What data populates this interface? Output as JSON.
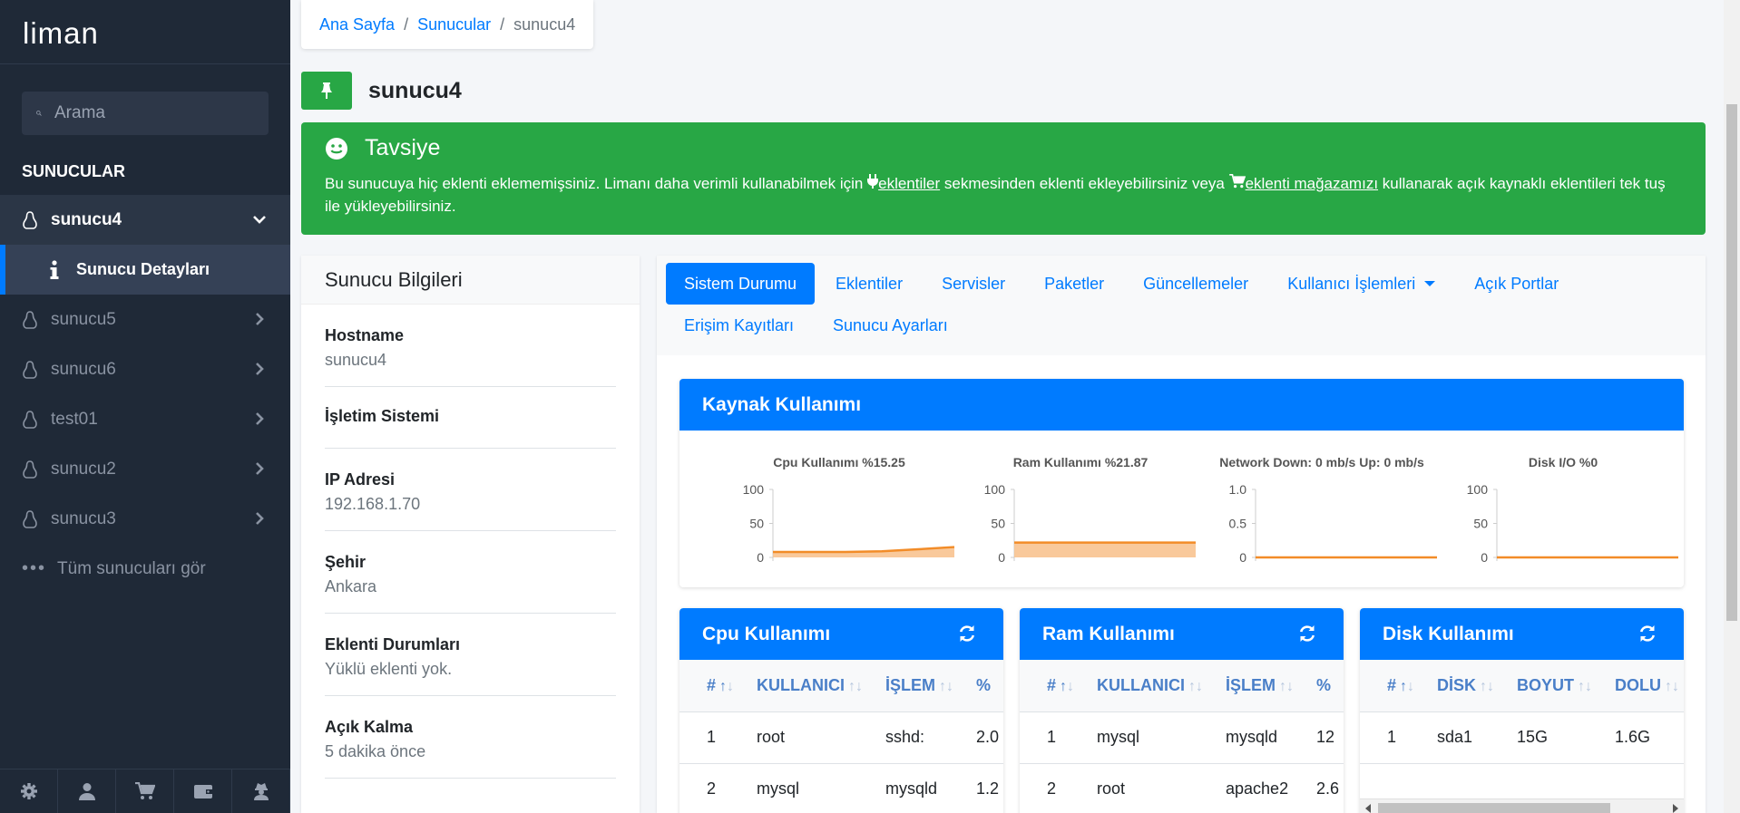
{
  "app": {
    "logo": "liman"
  },
  "sidebar": {
    "search_placeholder": "Arama",
    "section_title": "SUNUCULAR",
    "servers": [
      {
        "label": "sunucu4",
        "active": true
      },
      {
        "label": "sunucu5"
      },
      {
        "label": "sunucu6"
      },
      {
        "label": "test01"
      },
      {
        "label": "sunucu2"
      },
      {
        "label": "sunucu3"
      }
    ],
    "sub_item": "Sunucu Detayları",
    "see_all": "Tüm sunucuları gör"
  },
  "breadcrumb": {
    "home": "Ana Sayfa",
    "servers": "Sunucular",
    "current": "sunucu4"
  },
  "page": {
    "title": "sunucu4"
  },
  "alert": {
    "title": "Tavsiye",
    "text_1": "Bu sunucuya hiç eklenti eklememişsiniz. Limanı daha verimli kullanabilmek için ",
    "link_1": "eklentiler",
    "text_2": " sekmesinden eklenti ekleyebilirsiniz veya ",
    "link_2": "eklenti mağazamızı",
    "text_3": " kullanarak açık kaynaklı eklentileri tek tuş ile yükleyebilirsiniz."
  },
  "info": {
    "title": "Sunucu Bilgileri",
    "rows": [
      {
        "key": "Hostname",
        "value": "sunucu4"
      },
      {
        "key": "İşletim Sistemi",
        "value": ""
      },
      {
        "key": "IP Adresi",
        "value": "192.168.1.70"
      },
      {
        "key": "Şehir",
        "value": "Ankara"
      },
      {
        "key": "Eklenti Durumları",
        "value": "Yüklü eklenti yok."
      },
      {
        "key": "Açık Kalma",
        "value": "5 dakika önce"
      }
    ]
  },
  "tabs": [
    "Sistem Durumu",
    "Eklentiler",
    "Servisler",
    "Paketler",
    "Güncellemeler",
    "Kullanıcı İşlemleri",
    "Açık Portlar",
    "Erişim Kayıtları",
    "Sunucu Ayarları"
  ],
  "resource": {
    "title": "Kaynak Kullanımı",
    "charts": [
      {
        "title": "Cpu Kullanımı %15.25",
        "ticks": [
          "100",
          "50",
          "0"
        ],
        "max": 100,
        "values": [
          8,
          8,
          8,
          9,
          12,
          15.25
        ]
      },
      {
        "title": "Ram Kullanımı %21.87",
        "ticks": [
          "100",
          "50",
          "0"
        ],
        "max": 100,
        "values": [
          21.87,
          21.87,
          21.87,
          21.87,
          21.87,
          21.87
        ]
      },
      {
        "title": "Network Down: 0 mb/s Up: 0 mb/s",
        "ticks": [
          "1.0",
          "0.5",
          "0"
        ],
        "max": 1,
        "values": [
          0,
          0,
          0,
          0,
          0,
          0
        ]
      },
      {
        "title": "Disk I/O %0",
        "ticks": [
          "100",
          "50",
          "0"
        ],
        "max": 100,
        "values": [
          0,
          0,
          0,
          0,
          0,
          0
        ]
      }
    ],
    "line_color": "#f28c28",
    "fill_color": "#f8c08a"
  },
  "cpu_table": {
    "title": "Cpu Kullanımı",
    "columns": [
      "#",
      "KULLANICI",
      "İŞLEM",
      "%"
    ],
    "rows": [
      [
        "1",
        "root",
        "sshd:",
        "2.0"
      ],
      [
        "2",
        "mysql",
        "mysqld",
        "1.2"
      ]
    ]
  },
  "ram_table": {
    "title": "Ram Kullanımı",
    "columns": [
      "#",
      "KULLANICI",
      "İŞLEM",
      "%"
    ],
    "rows": [
      [
        "1",
        "mysql",
        "mysqld",
        "12"
      ],
      [
        "2",
        "root",
        "apache2",
        "2.6"
      ]
    ]
  },
  "disk_table": {
    "title": "Disk Kullanımı",
    "columns": [
      "#",
      "DİSK",
      "BOYUT",
      "DOLU"
    ],
    "rows": [
      [
        "1",
        "sda1",
        "15G",
        "1.6G"
      ]
    ]
  },
  "colors": {
    "sidebar_bg": "#1f2937",
    "primary": "#007bff",
    "success": "#28a745"
  }
}
